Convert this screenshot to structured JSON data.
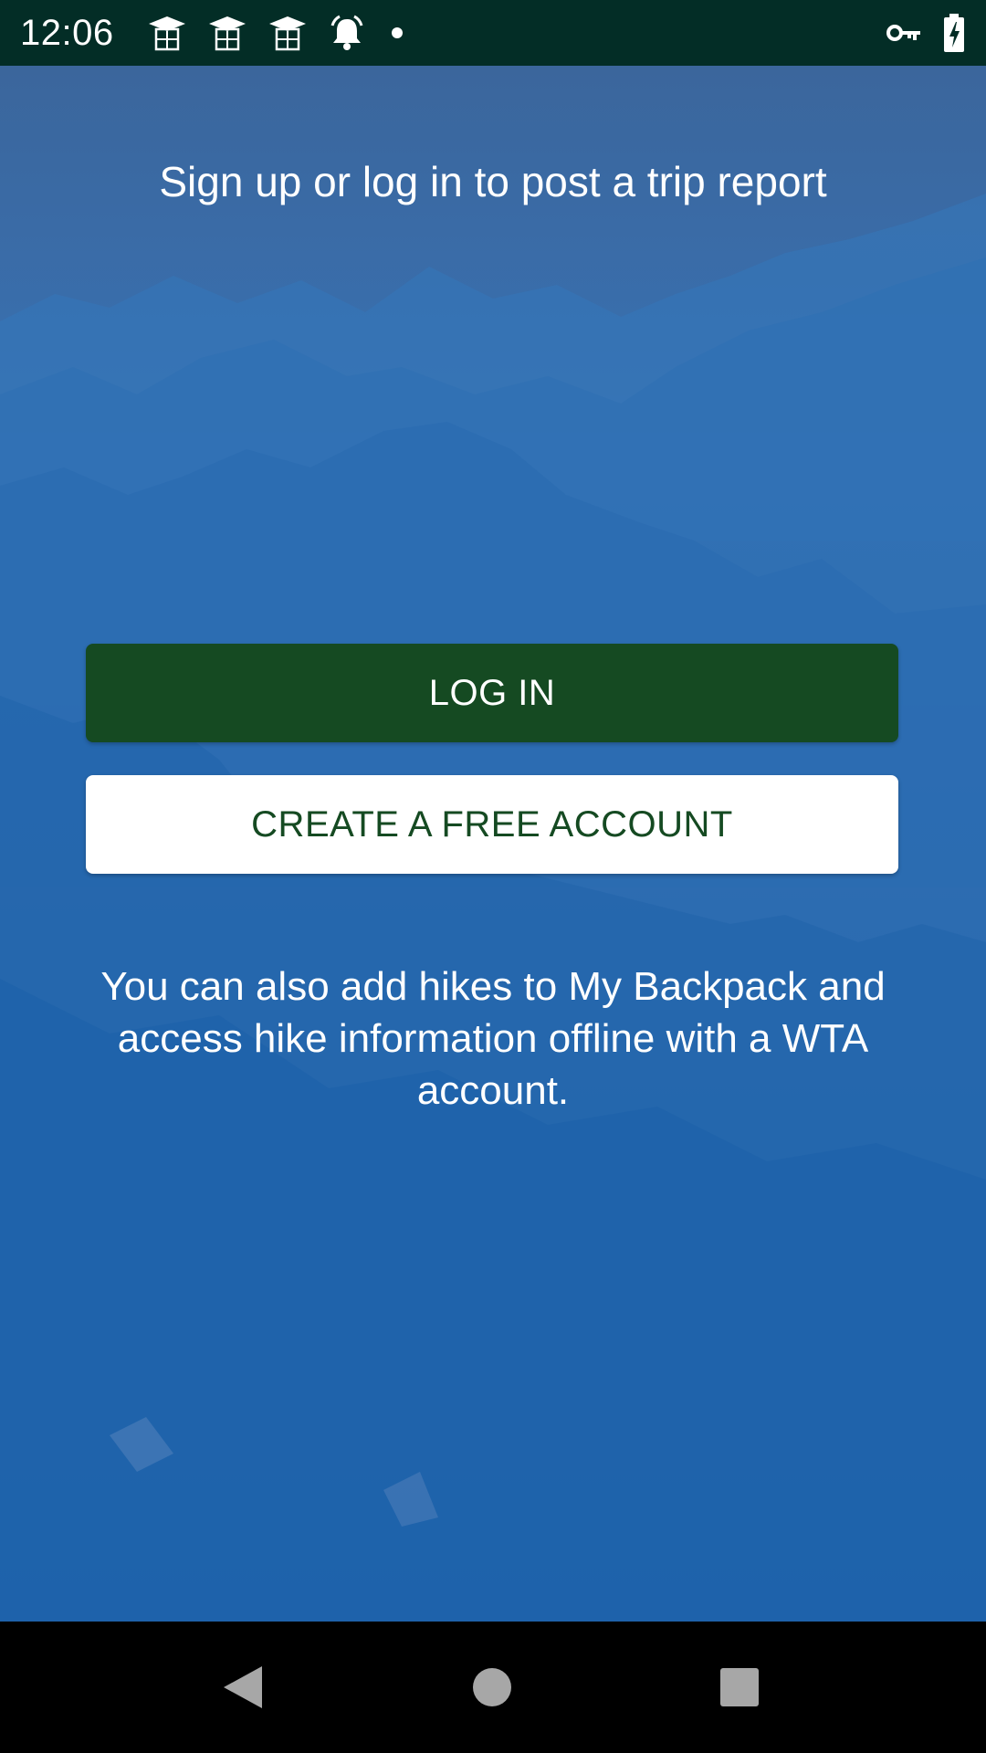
{
  "status_bar": {
    "time": "12:06",
    "left_icons": [
      "graduation-cap-icon",
      "graduation-cap-icon",
      "graduation-cap-icon",
      "alarm-bell-icon",
      "dot-icon"
    ],
    "right_icons": [
      "vpn-key-icon",
      "battery-charging-icon"
    ]
  },
  "main": {
    "headline": "Sign up or log in to post a trip report",
    "login_label": "LOG IN",
    "create_account_label": "CREATE A FREE ACCOUNT",
    "info_text": "You can also add hikes to My Backpack and access hike information offline with a WTA account."
  },
  "nav_bar": {
    "icons": [
      "back-icon",
      "home-icon",
      "recents-icon"
    ]
  },
  "colors": {
    "status_bar": "#032d26",
    "primary_green": "#154a22",
    "background_blue": "#2f6fb3",
    "white": "#ffffff"
  }
}
